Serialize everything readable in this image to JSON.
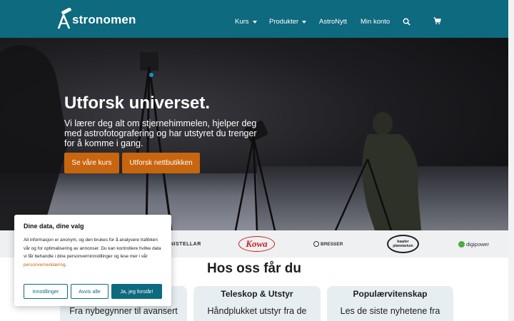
{
  "header": {
    "logo_text": "stronomen",
    "nav": [
      {
        "label": "Kurs",
        "has_dropdown": true
      },
      {
        "label": "Produkter",
        "has_dropdown": true
      },
      {
        "label": "AstroNytt",
        "has_dropdown": false
      },
      {
        "label": "Min konto",
        "has_dropdown": false
      }
    ],
    "search_icon": "search-icon",
    "cart_icon": "cart-icon"
  },
  "hero": {
    "title": "Utforsk universet.",
    "subtitle": "Vi lærer deg alt om stjernehimmelen, hjelper deg med astrofotografering og har utstyret du trenger for å komme i gang.",
    "buttons": [
      {
        "label": "Se våre kurs"
      },
      {
        "label": "Utforsk nettbutikken"
      }
    ]
  },
  "brands": [
    "NISTELLAR",
    "Kowa",
    "BRESSER",
    "baader planetarium",
    "digipower"
  ],
  "section": {
    "title": "Hos oss får du",
    "cards": [
      {
        "title": "",
        "text": "Fra nybegynner til avansert"
      },
      {
        "title": "Teleskop & Utstyr",
        "text": "Håndplukket utstyr fra de"
      },
      {
        "title": "Populærvitenskap",
        "text": "Les de siste nyhetene fra"
      }
    ]
  },
  "cookie": {
    "title": "Dine data, dine valg",
    "text": "All informasjon er anonym, og den brukes for å analysere trafikken vår og for optimalisering av annonser. Du kan kontrollere hvilke data vi får behandle i dine personverninnstillinger og lese mer i vår",
    "link": "personvernerklæring",
    "link_suffix": ".",
    "buttons": {
      "settings": "Innstillinger",
      "reject": "Avvis alle",
      "accept": "Ja, jeg forstår!"
    }
  },
  "colors": {
    "brand_teal": "#0e6a7e",
    "accent_orange": "#c8650f"
  }
}
